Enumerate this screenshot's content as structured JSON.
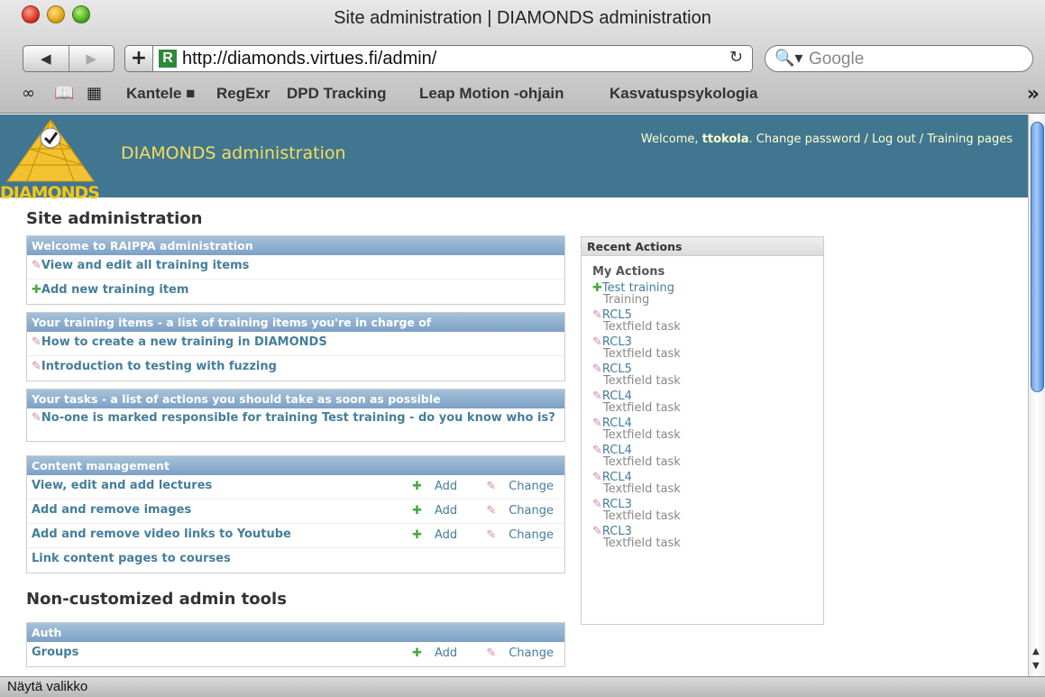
{
  "window": {
    "title": "Site administration | DIAMONDS administration"
  },
  "toolbar": {
    "back": "◀",
    "forward": "▶",
    "add": "+",
    "favicon_letter": "R",
    "url": "http://diamonds.virtues.fi/admin/",
    "reload": "↻",
    "search_placeholder": "Google"
  },
  "bookmarks": {
    "items": [
      "Kantele",
      "RegExr",
      "DPD Tracking",
      "Leap Motion -ohjain",
      "Kasvatuspsykologia"
    ],
    "more": "»"
  },
  "header": {
    "logo_text": "DIAMONDS",
    "site_name": "DIAMONDS administration",
    "welcome": "Welcome,",
    "username": "ttokola",
    "links": ". Change password / Log out / Training pages"
  },
  "content": {
    "title": "Site administration",
    "welcome_module": {
      "caption": "Welcome to RAIPPA administration",
      "rows": [
        "View and edit all training items",
        "Add new training item"
      ]
    },
    "training_module": {
      "caption": "Your training items - a list of training items you're in charge of",
      "rows": [
        "How to create a new training in DIAMONDS",
        "Introduction to testing with fuzzing"
      ]
    },
    "tasks_module": {
      "caption": "Your tasks - a list of actions you should take as soon as possible",
      "rows": [
        "No-one is marked responsible for training Test training - do you know who is?"
      ]
    },
    "content_module": {
      "caption": "Content management",
      "rows": [
        "View, edit and add lectures",
        "Add and remove images",
        "Add and remove video links to Youtube",
        "Link content pages to courses"
      ],
      "add_label": "Add",
      "change_label": "Change"
    },
    "noncustom_title": "Non-customized admin tools",
    "auth_module": {
      "caption": "Auth",
      "rows": [
        "Groups"
      ]
    }
  },
  "recent": {
    "caption": "Recent Actions",
    "subtitle": "My Actions",
    "items": [
      {
        "name": "Test training",
        "type": "Training"
      },
      {
        "name": "RCL5",
        "type": "Textfield task"
      },
      {
        "name": "RCL3",
        "type": "Textfield task"
      },
      {
        "name": "RCL5",
        "type": "Textfield task"
      },
      {
        "name": "RCL4",
        "type": "Textfield task"
      },
      {
        "name": "RCL4",
        "type": "Textfield task"
      },
      {
        "name": "RCL4",
        "type": "Textfield task"
      },
      {
        "name": "RCL4",
        "type": "Textfield task"
      },
      {
        "name": "RCL3",
        "type": "Textfield task"
      },
      {
        "name": "RCL3",
        "type": "Textfield task"
      }
    ]
  },
  "status_bar": {
    "text": "Näytä valikko"
  }
}
